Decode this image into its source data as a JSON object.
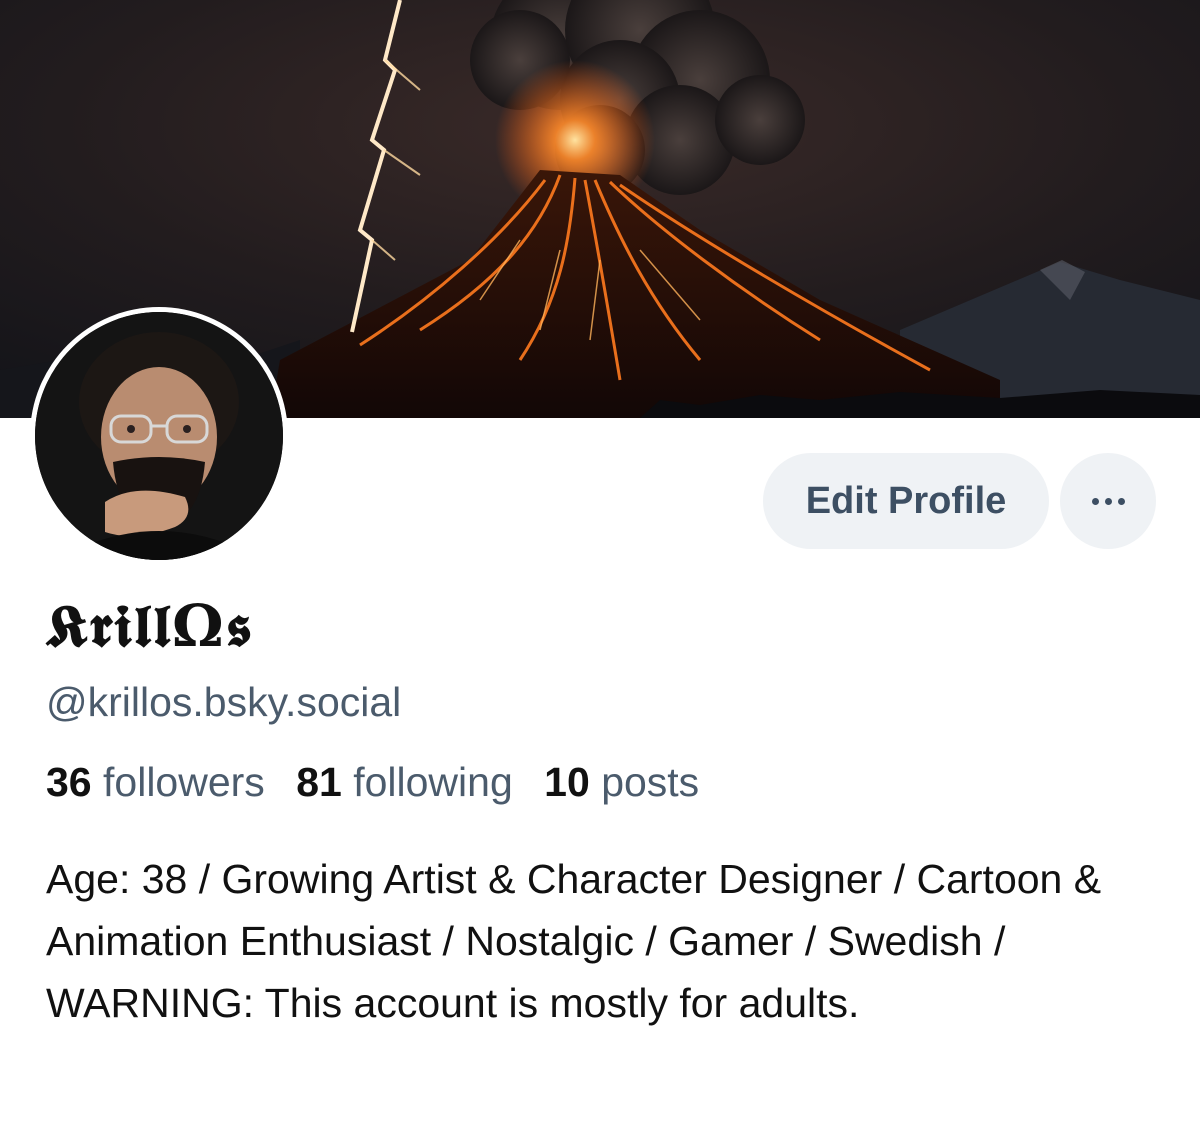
{
  "banner": {
    "alt": ""
  },
  "avatar": {
    "alt": ""
  },
  "actions": {
    "edit_profile_label": "Edit Profile",
    "more_icon": "ellipsis-icon"
  },
  "profile": {
    "display_name": "𝕶𝖗𝖎𝖑𝖑Ω𝖘",
    "handle": "@krillos.bsky.social",
    "stats": {
      "followers_count": "36",
      "followers_label": "followers",
      "following_count": "81",
      "following_label": "following",
      "posts_count": "10",
      "posts_label": "posts"
    },
    "bio": "Age: 38 / Growing Artist & Character Designer / Cartoon & Animation Enthusiast / Nostalgic / Gamer / Swedish / WARNING: This account is mostly for adults."
  },
  "colors": {
    "button_bg": "#eff2f5",
    "button_text": "#3d4f63",
    "secondary_text": "#4b5b6c",
    "primary_text": "#111111",
    "lava": "#ff7a1f"
  }
}
